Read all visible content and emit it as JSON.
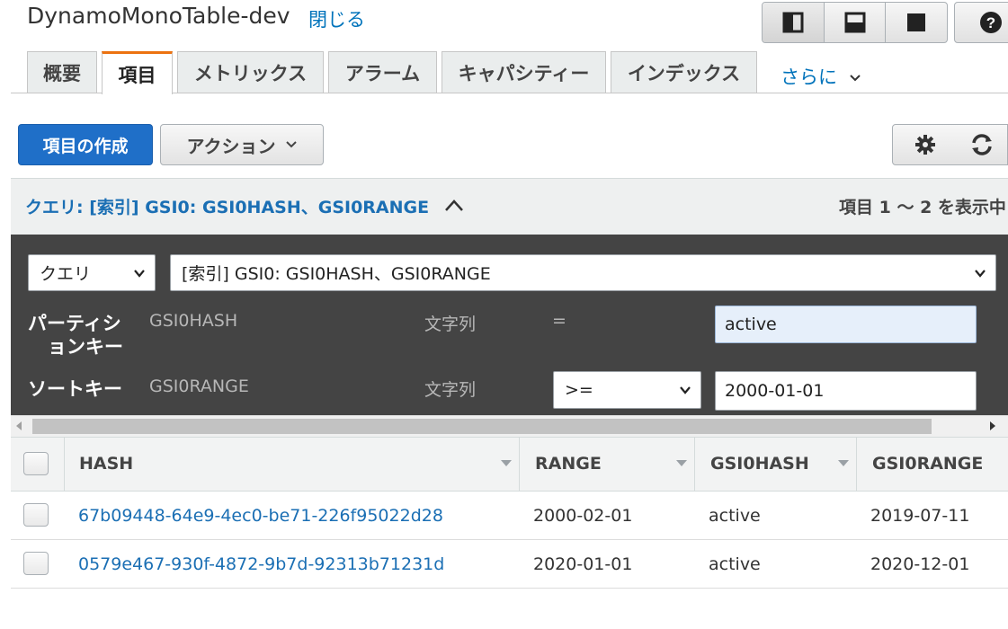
{
  "header": {
    "table_name": "DynamoMonoTable-dev",
    "close_label": "閉じる"
  },
  "tabs": [
    {
      "label": "概要"
    },
    {
      "label": "項目",
      "active": true
    },
    {
      "label": "メトリックス"
    },
    {
      "label": "アラーム"
    },
    {
      "label": "キャパシティー"
    },
    {
      "label": "インデックス"
    }
  ],
  "more_tabs_label": "さらに",
  "toolbar": {
    "create_label": "項目の作成",
    "action_label": "アクション"
  },
  "query": {
    "title": "クエリ: [索引] GSI0: GSI0HASH、GSI0RANGE",
    "item_count_text": "項目 1 〜 2 を表示中",
    "mode_value": "クエリ",
    "index_value": "[索引] GSI0: GSI0HASH、GSI0RANGE",
    "partition_key_label_line1": "パーティシ",
    "partition_key_label_line2": "ョンキー",
    "partition_key_name": "GSI0HASH",
    "partition_key_type": "文字列",
    "partition_operator": "=",
    "partition_value": "active",
    "sort_key_label": "ソートキー",
    "sort_key_name": "GSI0RANGE",
    "sort_key_type": "文字列",
    "sort_operator": ">=",
    "sort_value": "2000-01-01"
  },
  "table": {
    "columns": [
      "HASH",
      "RANGE",
      "GSI0HASH",
      "GSI0RANGE"
    ],
    "rows": [
      {
        "hash": "67b09448-64e9-4ec0-be71-226f95022d28",
        "range": "2000-02-01",
        "gsi0hash": "active",
        "gsi0range": "2019-07-11"
      },
      {
        "hash": "0579e467-930f-4872-9b7d-92313b71231d",
        "range": "2020-01-01",
        "gsi0hash": "active",
        "gsi0range": "2020-12-01"
      }
    ]
  },
  "colors": {
    "accent_blue": "#1f6fc8",
    "link_blue": "#1b6fb4",
    "active_tab_orange": "#ec7211",
    "query_panel_bg": "#444444"
  }
}
